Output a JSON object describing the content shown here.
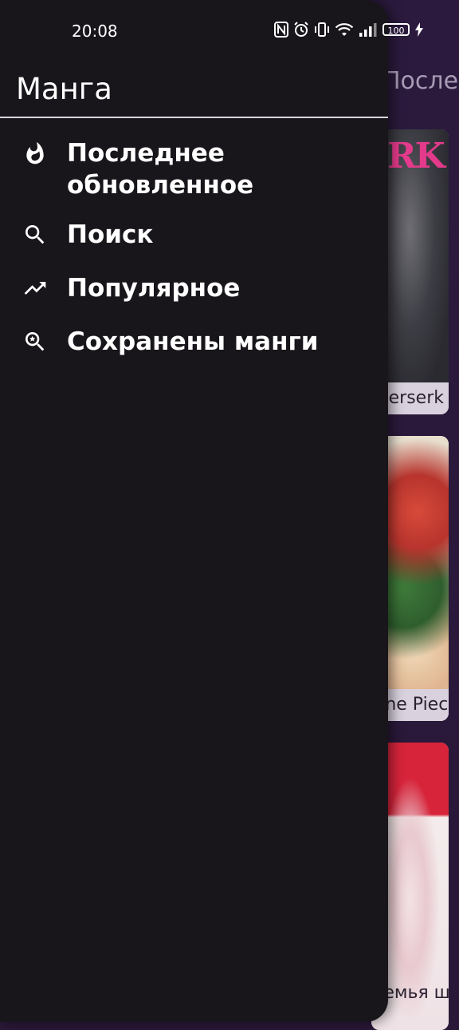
{
  "status": {
    "time": "20:08",
    "battery": "100"
  },
  "background": {
    "screen_title": "Последнее",
    "cards": [
      {
        "title": "Berserk"
      },
      {
        "title": "One Piece"
      },
      {
        "title": "Семья шпиона / Spy x Family"
      }
    ]
  },
  "drawer": {
    "title": "Манга",
    "items": [
      {
        "label": "Последнее обновленное",
        "icon": "fire-icon"
      },
      {
        "label": "Поиск",
        "icon": "search-icon"
      },
      {
        "label": "Популярное",
        "icon": "trending-up-icon"
      },
      {
        "label": "Сохранены манги",
        "icon": "search-star-icon"
      }
    ]
  },
  "colors": {
    "drawer_bg": "#18161b",
    "scrim_bg": "#2a1838",
    "text": "#ffffff"
  }
}
